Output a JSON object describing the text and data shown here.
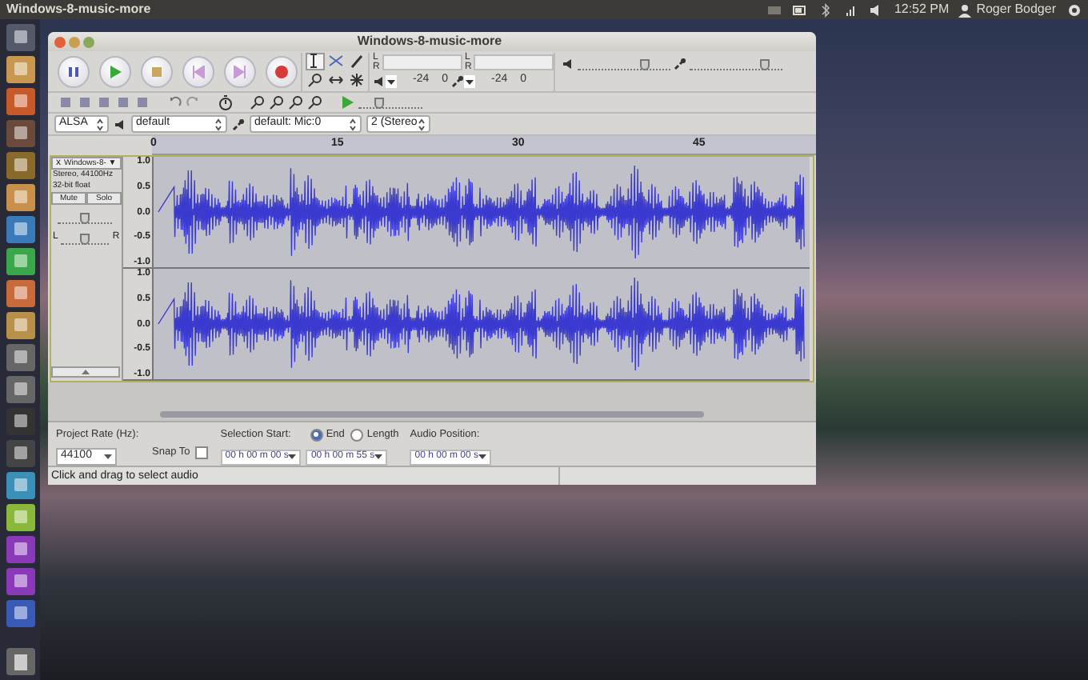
{
  "top_panel": {
    "app_title": "Windows-8-music-more",
    "time": "12:52 PM",
    "user": "Roger Bodger"
  },
  "window": {
    "title": "Windows-8-music-more"
  },
  "meters": {
    "record_channels": [
      "L",
      "R"
    ],
    "playback_channels": [
      "L",
      "R"
    ],
    "playback_ticks": [
      "-24",
      "0"
    ],
    "record_ticks": [
      "-24",
      "0"
    ]
  },
  "mixer": {
    "output": {
      "level": 0.75
    },
    "input": {
      "level": 0.85
    }
  },
  "play_at_speed": {
    "level": 0.3
  },
  "device": {
    "host": "ALSA",
    "output": "default",
    "input": "default: Mic:0",
    "channels": "2 (Stereo"
  },
  "ruler": [
    "0",
    "15",
    "30",
    "45"
  ],
  "track": {
    "close": "x",
    "name": "Windows-8-",
    "menu": "▼",
    "info": [
      "Stereo, 44100Hz",
      "32-bit float"
    ],
    "mute": "Mute",
    "solo": "Solo",
    "gain": {
      "level": 0.5
    },
    "pan_left": "L",
    "pan_right": "R",
    "pan": {
      "level": 0.5
    },
    "channels": [
      {
        "scale": [
          "1.0",
          "0.5",
          "0.0",
          "-0.5",
          "-1.0"
        ]
      },
      {
        "scale": [
          "1.0",
          "0.5",
          "0.0",
          "-0.5",
          "-1.0"
        ]
      }
    ]
  },
  "selection_bar": {
    "project_rate_label": "Project Rate (Hz):",
    "project_rate": "44100",
    "snap_label": "Snap To",
    "snap_checked": false,
    "selection_start_label": "Selection Start:",
    "modes": [
      {
        "label": "End",
        "selected": true
      },
      {
        "label": "Length",
        "selected": false
      }
    ],
    "start": "00 h 00 m 00 s",
    "end": "00 h 00 m 55 s",
    "audio_position_label": "Audio Position:",
    "audio_position": "00 h 00 m 00 s"
  },
  "status_bar": "Click and drag to select audio"
}
